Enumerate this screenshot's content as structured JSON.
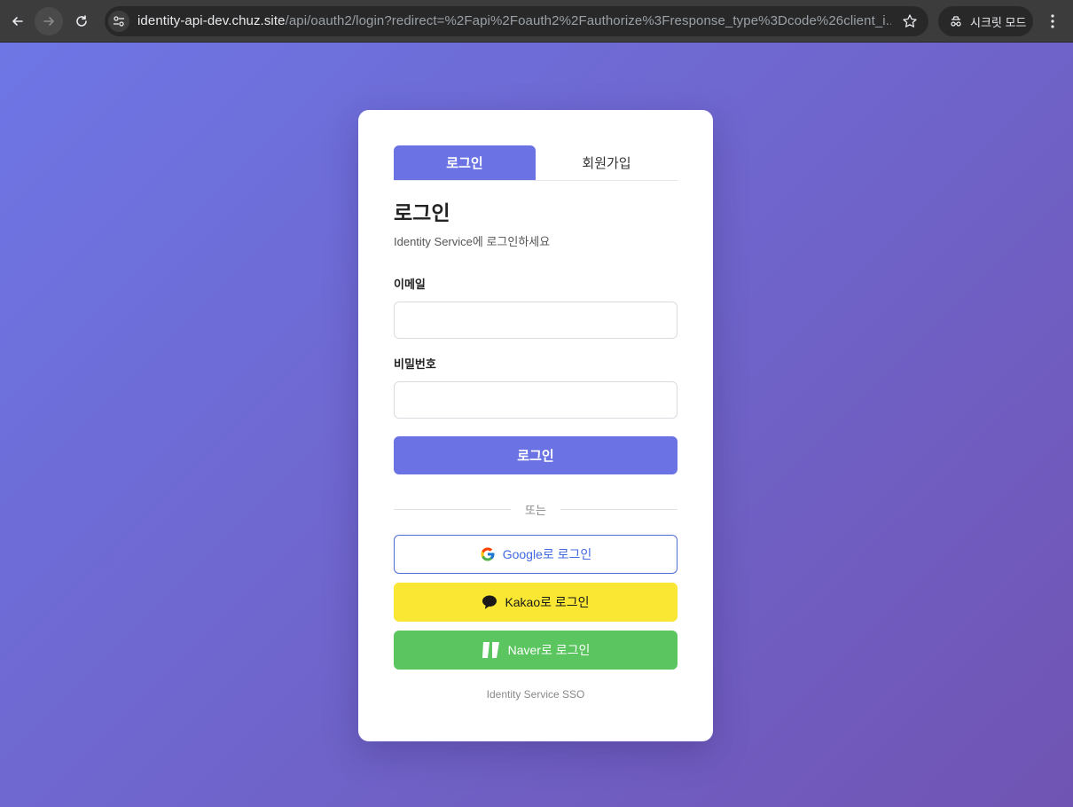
{
  "browser": {
    "url_host": "identity-api-dev.chuz.site",
    "url_path": "/api/oauth2/login?redirect=%2Fapi%2Foauth2%2Fauthorize%3Fresponse_type%3Dcode%26client_i...",
    "incognito_label": "시크릿 모드"
  },
  "tabs": {
    "login": "로그인",
    "signup": "회원가입"
  },
  "form": {
    "title": "로그인",
    "subtitle": "Identity Service에 로그인하세요",
    "email_label": "이메일",
    "email_value": "",
    "password_label": "비밀번호",
    "password_value": "",
    "submit_label": "로그인"
  },
  "divider": {
    "text": "또는"
  },
  "social": {
    "google": "Google로 로그인",
    "kakao": "Kakao로 로그인",
    "naver": "Naver로 로그인"
  },
  "footer": {
    "text": "Identity Service SSO"
  },
  "colors": {
    "primary": "#6b73e4",
    "kakao": "#f9e734",
    "naver": "#5bc55f",
    "google_text": "#4169e1"
  }
}
